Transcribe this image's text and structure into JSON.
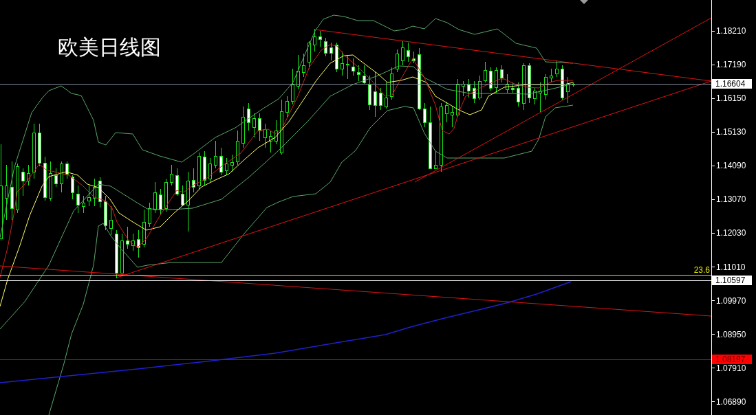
{
  "chart_title": "欧美日线图",
  "price_axis": {
    "ticks": [
      "1.18210",
      "1.17190",
      "1.16150",
      "1.15130",
      "1.14090",
      "1.13070",
      "1.12030",
      "1.11010",
      "1.09970",
      "1.08950",
      "1.07910",
      "1.06890"
    ]
  },
  "price_tags": [
    {
      "kind": "bid",
      "text": "1.16604"
    },
    {
      "kind": "level",
      "text": "1.10597"
    },
    {
      "kind": "alert",
      "text": "1.08197"
    }
  ],
  "fibo_level": {
    "label": "23.6"
  }
}
